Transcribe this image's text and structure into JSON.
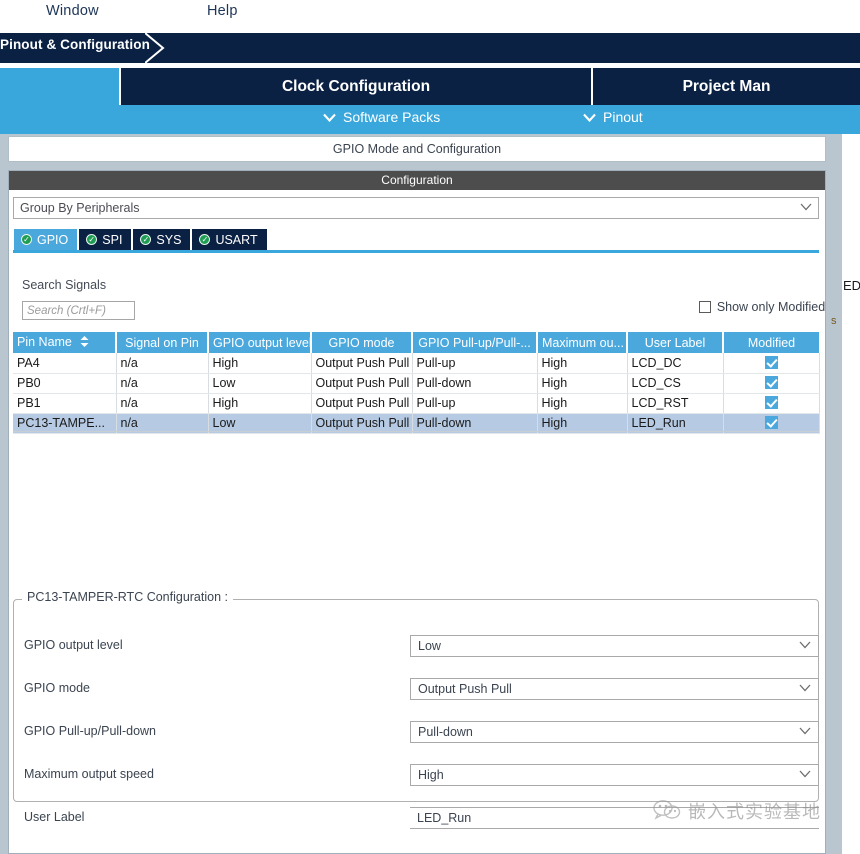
{
  "menubar": {
    "items": [
      {
        "label": "Window"
      },
      {
        "label": "Help"
      }
    ]
  },
  "breadcrumb": {
    "label": "Pinout & Configuration"
  },
  "tabs": [
    {
      "label": "",
      "name": "tab-pinout-configuration",
      "active": true
    },
    {
      "label": "Clock Configuration",
      "name": "tab-clock-configuration",
      "active": false
    },
    {
      "label": "Project Man",
      "name": "tab-project-manager",
      "active": false
    }
  ],
  "subnav": [
    {
      "label": "Software Packs",
      "icon": "chevron-down-icon"
    },
    {
      "label": "Pinout",
      "icon": "chevron-down-icon"
    }
  ],
  "panel": {
    "title": "GPIO Mode and Configuration",
    "configuration_header": "Configuration"
  },
  "group_by": {
    "value": "Group By Peripherals",
    "caret": "chevron-down-icon"
  },
  "peripheral_tabs": [
    {
      "label": "GPIO",
      "active": true
    },
    {
      "label": "SPI",
      "active": false
    },
    {
      "label": "SYS",
      "active": false
    },
    {
      "label": "USART",
      "active": false
    }
  ],
  "search": {
    "label": "Search Signals",
    "placeholder": "Search (Crtl+F)",
    "value": ""
  },
  "show_modified": {
    "label": "Show only Modified Pins",
    "checked": false
  },
  "pins_table": {
    "columns": [
      "Pin Name",
      "Signal on Pin",
      "GPIO output level",
      "GPIO mode",
      "GPIO Pull-up/Pull-...",
      "Maximum ou...",
      "User Label",
      "Modified"
    ],
    "sort_column": "Pin Name",
    "rows": [
      {
        "pin_name": "PA4",
        "signal_on_pin": "n/a",
        "gpio_output_level": "High",
        "gpio_mode": "Output Push Pull",
        "gpio_pull": "Pull-up",
        "max_output": "High",
        "user_label": "LCD_DC",
        "modified": true,
        "selected": false
      },
      {
        "pin_name": "PB0",
        "signal_on_pin": "n/a",
        "gpio_output_level": "Low",
        "gpio_mode": "Output Push Pull",
        "gpio_pull": "Pull-down",
        "max_output": "High",
        "user_label": "LCD_CS",
        "modified": true,
        "selected": false
      },
      {
        "pin_name": "PB1",
        "signal_on_pin": "n/a",
        "gpio_output_level": "High",
        "gpio_mode": "Output Push Pull",
        "gpio_pull": "Pull-up",
        "max_output": "High",
        "user_label": "LCD_RST",
        "modified": true,
        "selected": false
      },
      {
        "pin_name": "PC13-TAMPE...",
        "signal_on_pin": "n/a",
        "gpio_output_level": "Low",
        "gpio_mode": "Output Push Pull",
        "gpio_pull": "Pull-down",
        "max_output": "High",
        "user_label": "LED_Run",
        "modified": true,
        "selected": true
      }
    ]
  },
  "pin_config": {
    "legend": "PC13-TAMPER-RTC Configuration :",
    "fields": [
      {
        "label": "GPIO output level",
        "value": "Low",
        "type": "select"
      },
      {
        "label": "GPIO mode",
        "value": "Output Push Pull",
        "type": "select"
      },
      {
        "label": "GPIO Pull-up/Pull-down",
        "value": "Pull-down",
        "type": "select"
      },
      {
        "label": "Maximum output speed",
        "value": "High",
        "type": "select"
      },
      {
        "label": "User Label",
        "value": "LED_Run",
        "type": "input"
      }
    ]
  },
  "edge": {
    "clipped_text": "ED",
    "clipped_small": "s"
  },
  "watermark": {
    "text": "嵌入式实验基地",
    "icon": "wechat-icon"
  },
  "colors": {
    "navy": "#0b2144",
    "accent_blue": "#3aa7dc",
    "table_header": "#4aa8dd",
    "selected_row": "#b6cbe3",
    "panel_bg": "#b9c5cf",
    "config_header": "#4d4d4d",
    "check_green": "#1f9d55"
  }
}
